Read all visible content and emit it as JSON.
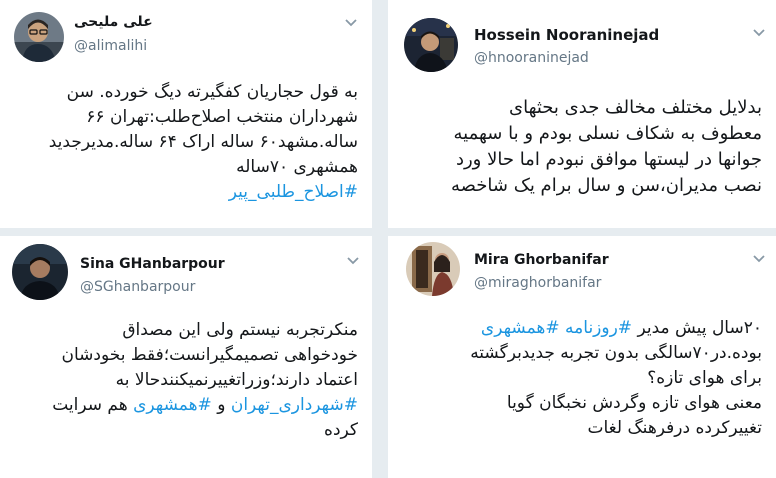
{
  "accent_color": "#1b95e0",
  "tweets": [
    {
      "name": "علی ملیحی",
      "handle": "@alimalihi",
      "avatar_icon": "profile-photo-man-glasses",
      "lines": [
        [
          {
            "t": "به قول حجاریان کفگیرته دیگ خورده. سن"
          }
        ],
        [
          {
            "t": "شهرداران منتخب اصلاح‌طلب:تهران ۶۶"
          }
        ],
        [
          {
            "t": "ساله.مشهد۶۰ ساله اراک ۶۴ ساله.مدیرجدید"
          }
        ],
        [
          {
            "t": "همشهری ۷۰ساله"
          }
        ],
        [
          {
            "t": "#اصلاح_طلبی_پیر",
            "tag": true
          }
        ]
      ]
    },
    {
      "name": "Hossein Nooraninejad",
      "handle": "@hnooraninejad",
      "avatar_icon": "profile-photo-man-night-street",
      "lines": [
        [
          {
            "t": "بدلایل مختلف مخالف جدی بحثهای"
          }
        ],
        [
          {
            "t": "معطوف به شکاف نسلی بودم و با سهمیه"
          }
        ],
        [
          {
            "t": "جوانها در لیستها موافق نبودم اما حالا ورد"
          }
        ],
        [
          {
            "t": "نصب مدیران،سن و سال برام یک شاخصه"
          }
        ]
      ]
    },
    {
      "name": "Sina GHanbarpour",
      "handle": "@SGhanbarpour",
      "avatar_icon": "profile-photo-man-dark",
      "lines": [
        [
          {
            "t": "منکرتجربه نیستم ولی این مصداق"
          }
        ],
        [
          {
            "t": "خودخواهی تصمیمگیرانست؛فقط بخودشان"
          }
        ],
        [
          {
            "t": "اعتماد دارند؛وزراتغییرنمیکنندحالا به"
          }
        ],
        [
          {
            "t": "#شهرداری_تهران",
            "tag": true
          },
          {
            "t": " و "
          },
          {
            "t": "#همشهری",
            "tag": true
          },
          {
            "t": " هم سرایت"
          }
        ],
        [
          {
            "t": "کرده"
          }
        ]
      ]
    },
    {
      "name": "Mira Ghorbanifar",
      "handle": "@miraghorbanifar",
      "avatar_icon": "profile-photo-woman-doorway",
      "lines": [
        [
          {
            "t": "۲۰سال پیش مدیر "
          },
          {
            "t": "#روزنامه",
            "tag": true
          },
          {
            "t": " "
          },
          {
            "t": "#همشهری",
            "tag": true
          }
        ],
        [
          {
            "t": "بوده.در۷۰سالگی بدون تجربه جدیدبرگشته"
          }
        ],
        [
          {
            "t": "برای هوای تازه؟"
          }
        ],
        [
          {
            "t": "معنی هوای تازه وگردش نخبگان گویا"
          }
        ],
        [
          {
            "t": "تغییرکرده درفرهنگ لغات"
          }
        ]
      ]
    }
  ]
}
